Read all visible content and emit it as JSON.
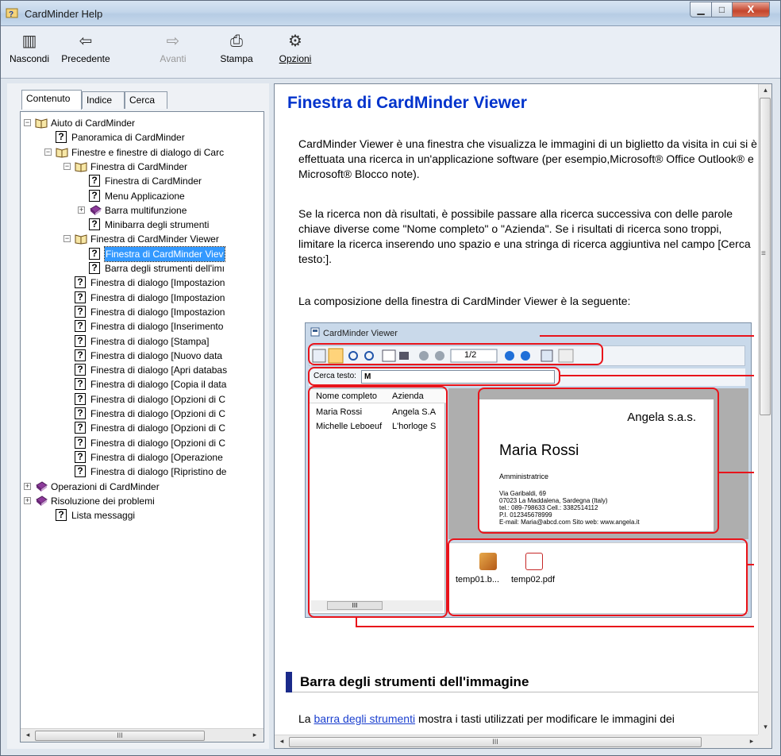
{
  "window": {
    "title": "CardMinder Help",
    "minimize_icon": "minimize-icon",
    "maximize_icon": "maximize-icon",
    "close_icon": "close-icon",
    "min_glyph": "▁",
    "max_glyph": "□",
    "close_glyph": "X"
  },
  "toolbar": {
    "buttons": [
      {
        "label": "Nascondi",
        "icon": "hide-pane-icon",
        "glyph": "▥",
        "enabled": true
      },
      {
        "label": "Precedente",
        "icon": "back-arrow-icon",
        "glyph": "⇦",
        "enabled": true
      },
      {
        "label": "Avanti",
        "icon": "forward-arrow-icon",
        "glyph": "⇨",
        "enabled": false
      },
      {
        "label": "Stampa",
        "icon": "printer-icon",
        "glyph": "⎙",
        "enabled": true
      },
      {
        "label": "Opzioni",
        "icon": "options-icon",
        "glyph": "⚙",
        "enabled": true
      }
    ]
  },
  "nav": {
    "tabs": [
      "Contenuto",
      "Indice",
      "Cerca"
    ],
    "active_tab": "Contenuto",
    "tree": [
      {
        "label": "Aiuto di CardMinder",
        "type": "book-open",
        "level": 0,
        "expander": "−"
      },
      {
        "label": "Panoramica di CardMinder",
        "type": "page",
        "level": 1
      },
      {
        "label": "Finestre e finestre di dialogo di Carc",
        "type": "book-open",
        "level": 1,
        "expander": "−"
      },
      {
        "label": "Finestra di CardMinder",
        "type": "book-open",
        "level": 2,
        "expander": "−"
      },
      {
        "label": "Finestra di CardMinder",
        "type": "page",
        "level": 3
      },
      {
        "label": "Menu Applicazione",
        "type": "page",
        "level": 3
      },
      {
        "label": "Barra multifunzione",
        "type": "book-closed",
        "level": 3,
        "expander": "+"
      },
      {
        "label": "Minibarra degli strumenti",
        "type": "page",
        "level": 3
      },
      {
        "label": "Finestra di CardMinder Viewer",
        "type": "book-open",
        "level": 2,
        "expander": "−"
      },
      {
        "label": "Finestra di CardMinder Viev",
        "type": "page",
        "level": 3,
        "selected": true
      },
      {
        "label": "Barra degli strumenti dell'imı",
        "type": "page",
        "level": 3
      },
      {
        "label": "Finestra di dialogo [Impostazion",
        "type": "page",
        "level": 2
      },
      {
        "label": "Finestra di dialogo [Impostazion",
        "type": "page",
        "level": 2
      },
      {
        "label": "Finestra di dialogo [Impostazion",
        "type": "page",
        "level": 2
      },
      {
        "label": "Finestra di dialogo [Inserimento",
        "type": "page",
        "level": 2
      },
      {
        "label": "Finestra di dialogo [Stampa]",
        "type": "page",
        "level": 2
      },
      {
        "label": "Finestra di dialogo [Nuovo data",
        "type": "page",
        "level": 2
      },
      {
        "label": "Finestra di dialogo [Apri databas",
        "type": "page",
        "level": 2
      },
      {
        "label": "Finestra di dialogo [Copia il data",
        "type": "page",
        "level": 2
      },
      {
        "label": "Finestra di dialogo [Opzioni di C",
        "type": "page",
        "level": 2
      },
      {
        "label": "Finestra di dialogo [Opzioni di C",
        "type": "page",
        "level": 2
      },
      {
        "label": "Finestra di dialogo [Opzioni di C",
        "type": "page",
        "level": 2
      },
      {
        "label": "Finestra di dialogo [Opzioni di C",
        "type": "page",
        "level": 2
      },
      {
        "label": "Finestra di dialogo [Operazione",
        "type": "page",
        "level": 2
      },
      {
        "label": "Finestra di dialogo [Ripristino de",
        "type": "page",
        "level": 2
      },
      {
        "label": "Operazioni di CardMinder",
        "type": "book-closed",
        "level": 0,
        "expander": "+"
      },
      {
        "label": "Risoluzione dei problemi",
        "type": "book-closed",
        "level": 0,
        "expander": "+"
      },
      {
        "label": "Lista messaggi",
        "type": "page",
        "level": 1
      }
    ],
    "page_glyph": "?",
    "scroll_left": "◂",
    "scroll_right": "▸",
    "scroll_thumb": "III"
  },
  "article": {
    "title": "Finestra di CardMinder Viewer",
    "para1": "CardMinder Viewer è una finestra che visualizza le immagini di un biglietto da visita in cui si è effettuata una ricerca in un'applicazione software (per esempio,Microsoft® Office Outlook® e Microsoft® Blocco note).",
    "para2": "Se la ricerca non dà risultati, è possibile passare alla ricerca successiva con delle parole chiave diverse come \"Nome completo\" o \"Azienda\". Se i risultati di ricerca sono troppi, limitare la ricerca inserendo uno spazio e una stringa di ricerca aggiuntiva nel campo [Cerca testo:].",
    "para3": "La composizione della finestra di CardMinder Viewer è la seguente:",
    "section2_title": "Barra degli strumenti dell'immagine",
    "para4_prefix": "La ",
    "para4_link": "barra degli strumenti",
    "para4_suffix": " mostra i tasti utilizzati per modificare le immagini dei",
    "scroll_up": "▴",
    "scroll_down": "▾",
    "scroll_left": "◂",
    "scroll_right": "▸",
    "scroll_thumb": "III",
    "vthumb_grip": "≡"
  },
  "figure": {
    "window_title": "CardMinder Viewer",
    "page_counter": "1/2",
    "search_label": "Cerca testo:",
    "search_value": "M",
    "columns": [
      "Nome completo",
      "Azienda"
    ],
    "rows": [
      [
        "Maria Rossi",
        "Angela S.A"
      ],
      [
        "Michelle Leboeuf",
        "L'horloge S"
      ]
    ],
    "card": {
      "company": "Angela s.a.s.",
      "name": "Maria Rossi",
      "role": "Amministratrice",
      "address": [
        "Via Garibaldi, 69",
        "07023 La Maddalena, Sardegna (Italy)",
        "tel.: 089-798633   Cell.: 3382514112",
        "P.I. 012345678999",
        "E-mail: Maria@abcd.com     Sito web: www.angela.it"
      ]
    },
    "files": [
      "temp01.b...",
      "temp02.pdf"
    ],
    "scroll_thumb": "III",
    "accent_red": "#e8141b"
  }
}
